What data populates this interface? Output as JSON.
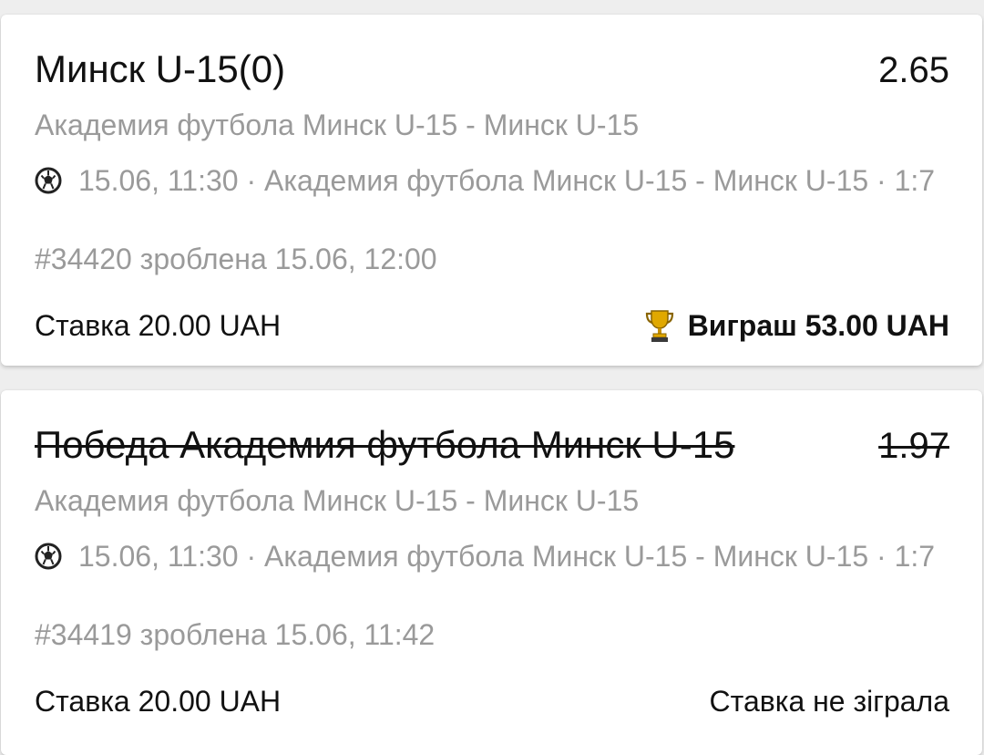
{
  "bets": [
    {
      "title": "Минск U-15(0)",
      "odds": "2.65",
      "struck": false,
      "match": "Академия футбола Минск U-15 - Минск U-15",
      "event_info": "15.06, 11:30 · Академия футбола Минск U-15 - Минск U-15 · 1:7",
      "bet_id": "#34420 зроблена 15.06, 12:00",
      "stake": "Ставка 20.00 UAH",
      "result": "Виграш 53.00 UAH",
      "result_icon": "trophy-icon"
    },
    {
      "title": "Победа Академия футбола Минск U-15",
      "odds": "1.97",
      "struck": true,
      "match": "Академия футбола Минск U-15 - Минск U-15",
      "event_info": "15.06, 11:30 · Академия футбола Минск U-15 - Минск U-15 · 1:7",
      "bet_id": "#34419 зроблена 15.06, 11:42",
      "stake": "Ставка 20.00 UAH",
      "result": "Ставка не зіграла"
    }
  ],
  "icons": {
    "sport": "soccer-ball-icon"
  },
  "colors": {
    "primary_text": "#111111",
    "secondary_text": "#9a9a9a",
    "trophy": "#d9a300"
  }
}
